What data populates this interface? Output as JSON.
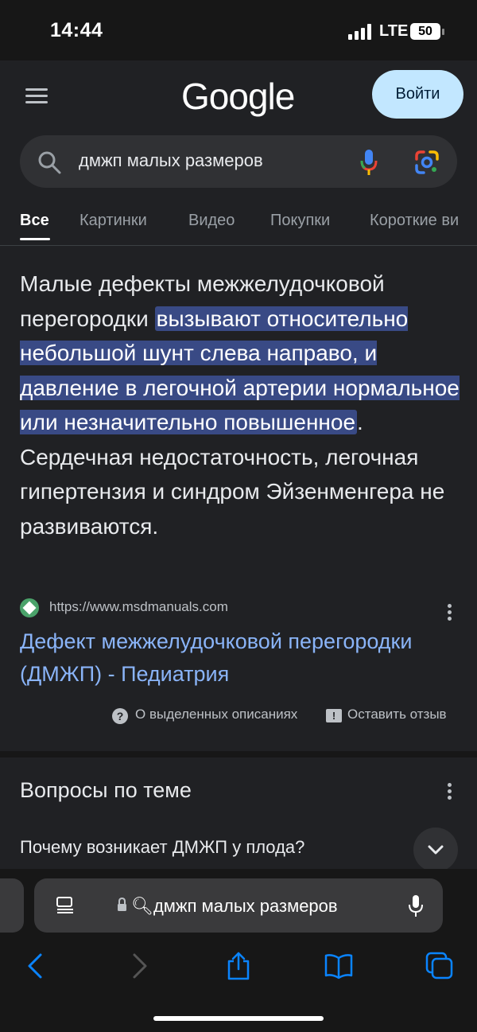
{
  "status_bar": {
    "time": "14:44",
    "network": "LTE",
    "battery": "50"
  },
  "header": {
    "logo": "Google",
    "login_label": "Войти"
  },
  "search": {
    "query": "дмжп малых размеров"
  },
  "tabs": [
    "Все",
    "Картинки",
    "Видео",
    "Покупки",
    "Короткие ви"
  ],
  "snippet": {
    "pre": "Малые дефекты межжелудочковой перегородки ",
    "highlight": "вызывают относительно небольшой шунт слева направо, и давление в легочной артерии нормальное или незначительно повышенное",
    "post": ". Сердечная недостаточность, легочная гипертензия и синдром Эйзенменгера не развиваются.",
    "source_url": "https://www.msdmanuals.com",
    "link_title": "Дефект межжелудочковой перегородки (ДМЖП) - Педиатрия",
    "about_label": "О выделенных описаниях",
    "feedback_label": "Оставить отзыв"
  },
  "questions": {
    "title": "Вопросы по теме",
    "items": [
      "Почему возникает ДМЖП у плода?"
    ]
  },
  "browser": {
    "address_text": "дмжп малых размеров"
  },
  "colors": {
    "background": "#202124",
    "highlight": "#394a85",
    "link": "#8ab4f8",
    "login_button": "#c2e7ff",
    "browser_accent": "#0a84ff"
  }
}
